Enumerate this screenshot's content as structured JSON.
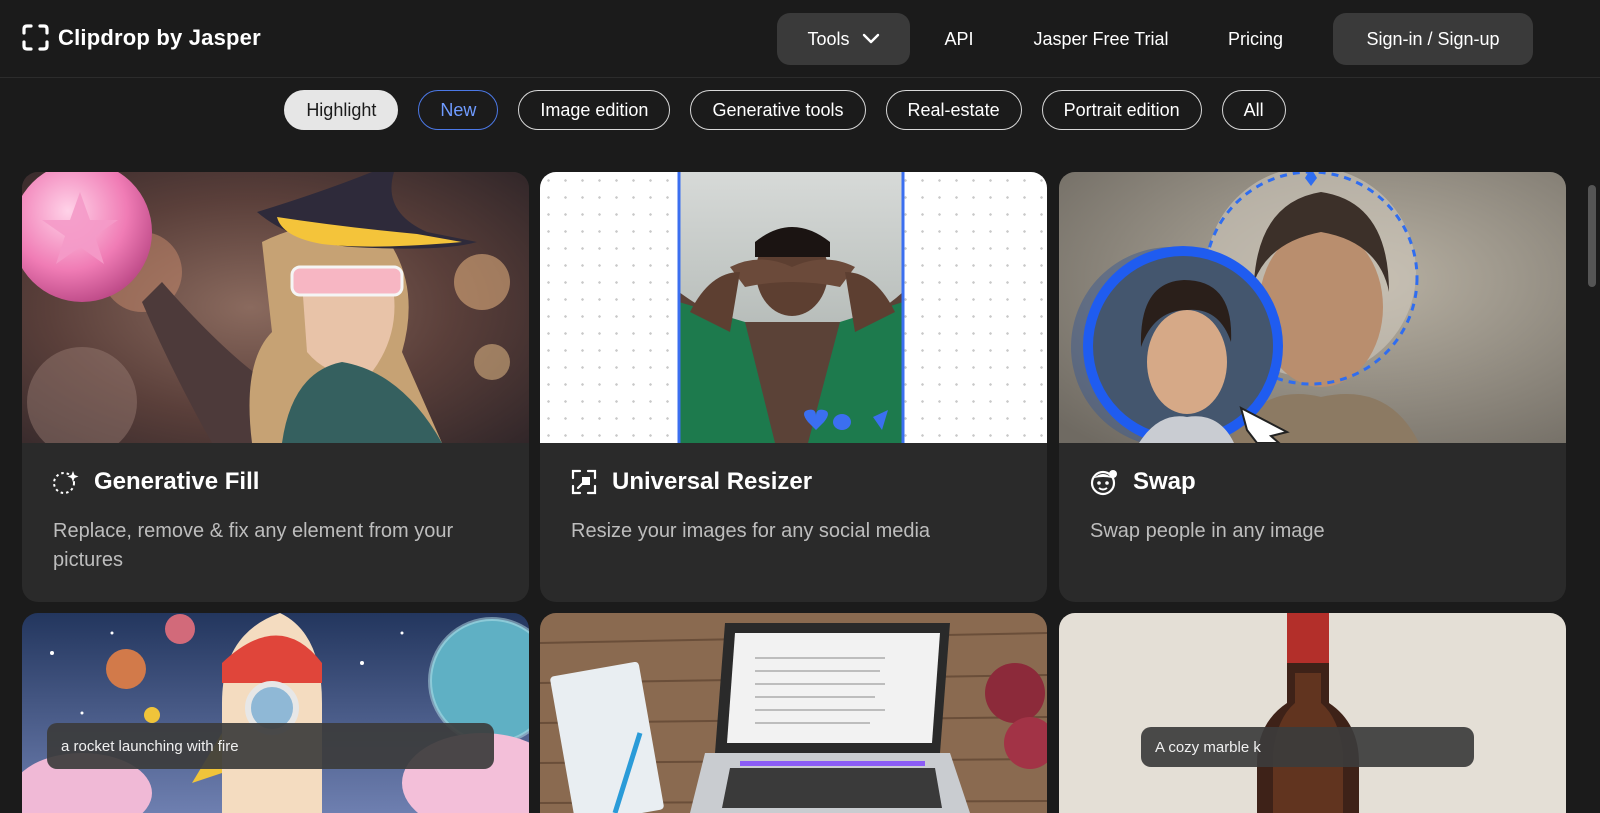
{
  "brand": {
    "name": "Clipdrop by Jasper"
  },
  "nav": {
    "tools": "Tools",
    "api": "API",
    "trial": "Jasper Free Trial",
    "pricing": "Pricing",
    "signin": "Sign-in / Sign-up"
  },
  "filters": [
    {
      "label": "Highlight",
      "state": "selected"
    },
    {
      "label": "New",
      "state": "new"
    },
    {
      "label": "Image edition",
      "state": ""
    },
    {
      "label": "Generative tools",
      "state": ""
    },
    {
      "label": "Real-estate",
      "state": ""
    },
    {
      "label": "Portrait edition",
      "state": ""
    },
    {
      "label": "All",
      "state": ""
    }
  ],
  "cards": [
    {
      "title": "Generative Fill",
      "description": "Replace, remove & fix any element from your pictures",
      "icon": "sparkle-circle-icon"
    },
    {
      "title": "Universal Resizer",
      "description": "Resize your images for any social media",
      "icon": "resize-icon"
    },
    {
      "title": "Swap",
      "description": "Swap people in any image",
      "icon": "face-swap-icon"
    }
  ],
  "row2": [
    {
      "prompt": "a rocket launching with fire"
    },
    {
      "prompt": ""
    },
    {
      "prompt": "A cozy marble k"
    }
  ],
  "colors": {
    "accent": "#3b6ff0",
    "background": "#1b1b1b",
    "card": "#2a2a2a"
  }
}
